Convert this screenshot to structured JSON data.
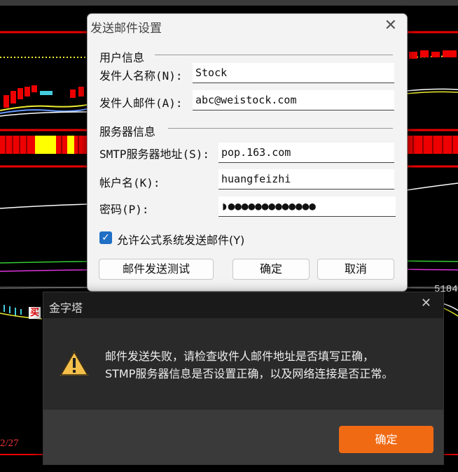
{
  "background": {
    "chart_date_label": "2/27",
    "price_label": "5184",
    "buy_badge": "买"
  },
  "settings_dialog": {
    "title": "发送邮件设置",
    "close_glyph": "✕",
    "user_section": "用户信息",
    "sender_name_label": "发件人名称(N):",
    "sender_name_value": "Stock",
    "sender_email_label": "发件人邮件(A):",
    "sender_email_value": "abc@weistock.com",
    "server_section": "服务器信息",
    "smtp_label": "SMTP服务器地址(S):",
    "smtp_value": "pop.163.com",
    "account_label": "帐户名(K):",
    "account_value": "huangfeizhi",
    "password_label": "密码(P):",
    "password_value": "◗●●●●●●●●●●●●●",
    "allow_checkbox_label": "允许公式系统发送邮件(Y)",
    "allow_checked": true,
    "test_button": "邮件发送测试",
    "ok_button": "确定",
    "cancel_button": "取消"
  },
  "alert_dialog": {
    "title": "金字塔",
    "close_glyph": "✕",
    "icon": "warning-triangle-icon",
    "message_line1": "邮件发送失败，请检查收件人邮件地址是否填写正确，",
    "message_line2": "STMP服务器信息是否设置正确，以及网络连接是否正常。",
    "ok_button": "确定",
    "accent_color": "#f06a14"
  }
}
